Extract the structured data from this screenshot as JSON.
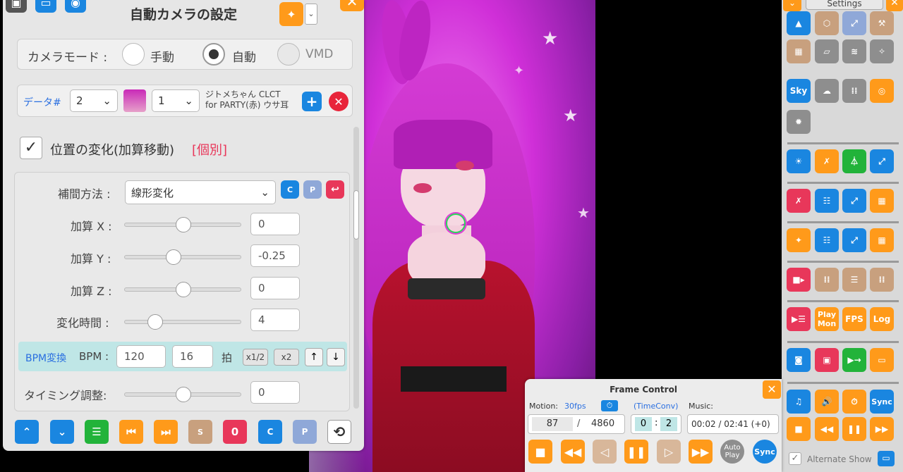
{
  "camera_panel": {
    "title": "自動カメラの設定",
    "mode_label": "カメラモード :",
    "mode_manual": "手動",
    "mode_auto": "自動",
    "mode_vmd": "VMD",
    "data_label": "データ#",
    "data_value": "2",
    "model_value": "1",
    "model_name_line1": "ジトメちゃん CLCT",
    "model_name_line2": "for PARTY(赤) ウサ耳",
    "position_change_label": "位置の変化(加算移動)",
    "individual_tag": "[個別]",
    "interp_label": "補間方法 :",
    "interp_value": "線形変化",
    "add_x_label": "加算 X :",
    "add_x_value": "0",
    "add_y_label": "加算 Y :",
    "add_y_value": "-0.25",
    "add_z_label": "加算 Z :",
    "add_z_value": "0",
    "change_time_label": "変化時間 :",
    "change_time_value": "4",
    "bpm_convert_label": "BPM変換",
    "bpm_label": "BPM :",
    "bpm_value": "120",
    "beats_value": "16",
    "beats_unit": "拍",
    "half_label": "x1/2",
    "double_label": "x2",
    "timing_label": "タイミング調整:",
    "timing_value": "0",
    "copy_icon_letter": "C",
    "paste_icon_letter": "P",
    "s_letter": "S",
    "zero_letter": "0"
  },
  "right_panel": {
    "header": "Settings",
    "sky_label": "Sky",
    "play_mon_line1": "Play",
    "play_mon_line2": "Mon",
    "fps_label": "FPS",
    "log_label": "Log",
    "sync_label": "Sync",
    "alternate_show_label": "Alternate Show"
  },
  "frame_control": {
    "title": "Frame Control",
    "motion_label": "Motion:",
    "fps_label": "30fps",
    "timeconv_label": "(TimeConv)",
    "music_label": "Music:",
    "current_frame": "87",
    "separator": "/",
    "total_frames": "4860",
    "conv_a": "0",
    "conv_b": "2",
    "conv_sep": ":",
    "music_time": "00:02 / 02:41 (+0)",
    "auto_play_line1": "Auto",
    "auto_play_line2": "Play",
    "sync_label": "Sync"
  },
  "colors": {
    "blue": "#1a86e0",
    "orange": "#ff9a1a",
    "green": "#22b33a",
    "red": "#e8375a",
    "tan": "#c8a07e",
    "gray": "#8e8e8e"
  }
}
